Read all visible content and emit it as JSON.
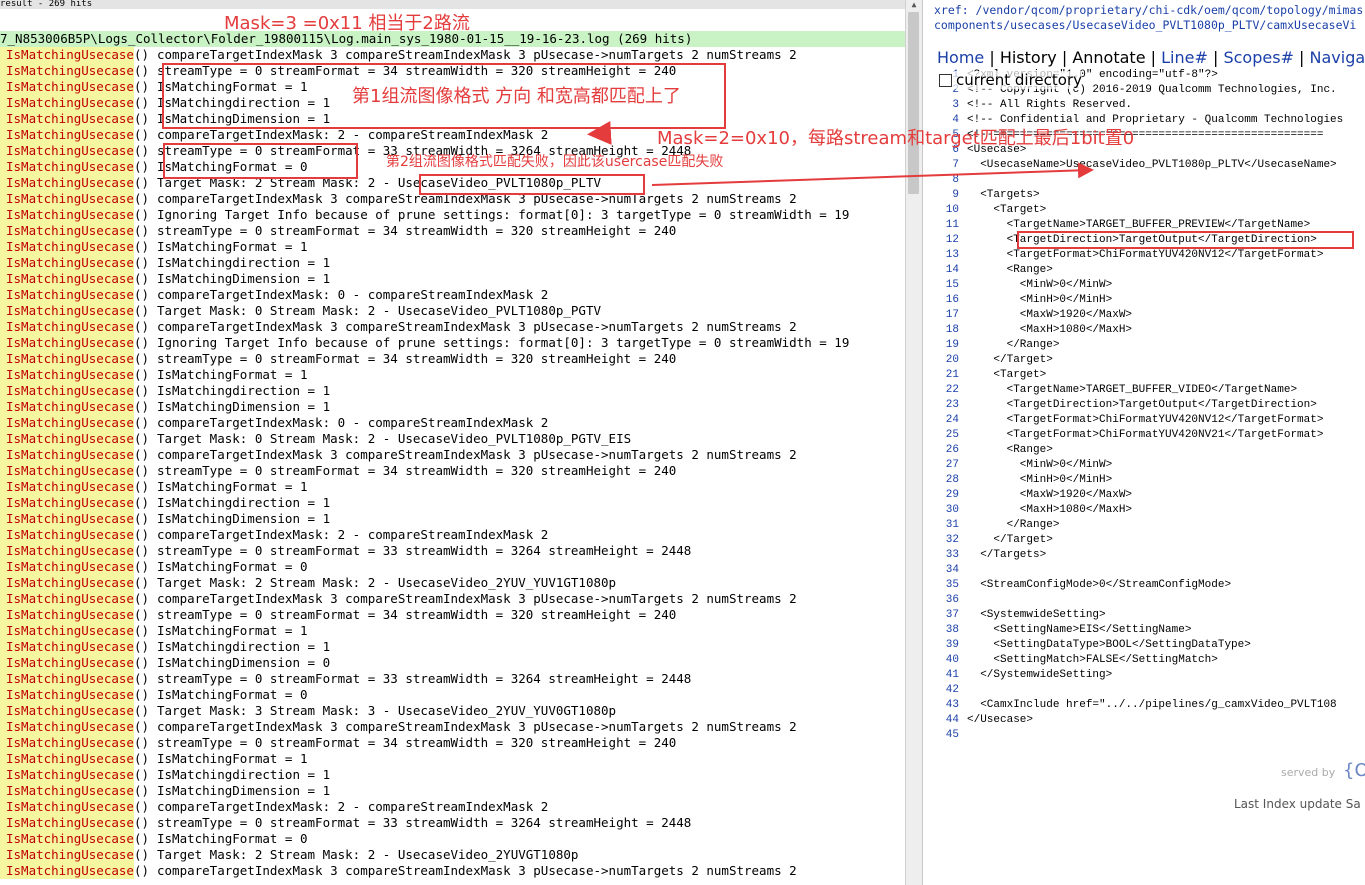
{
  "left_pane": {
    "result_header": "result - 269 hits",
    "path": "7_N853006B5P\\Logs_Collector\\Folder_19800115\\Log.main_sys_1980-01-15__19-16-23.log (269 hits)",
    "function_name": "IsMatchingUsecase",
    "paren": "()",
    "lines": [
      "compareTargetIndexMask 3 compareStreamIndexMask 3 pUsecase->numTargets 2 numStreams 2",
      "streamType = 0 streamFormat = 34 streamWidth = 320 streamHeight = 240",
      "IsMatchingFormat = 1",
      "IsMatchingdirection = 1",
      "IsMatchingDimension = 1",
      "compareTargetIndexMask: 2 - compareStreamIndexMask 2",
      "streamType = 0 streamFormat = 33 streamWidth = 3264 streamHeight = 2448",
      "IsMatchingFormat = 0",
      "Target Mask: 2 Stream Mask: 2 - UsecaseVideo_PVLT1080p_PLTV",
      "compareTargetIndexMask 3 compareStreamIndexMask 3 pUsecase->numTargets 2 numStreams 2",
      "Ignoring Target Info because of prune settings: format[0]: 3 targetType = 0 streamWidth = 19",
      "streamType = 0 streamFormat = 34 streamWidth = 320 streamHeight = 240",
      "IsMatchingFormat = 1",
      "IsMatchingdirection = 1",
      "IsMatchingDimension = 1",
      "compareTargetIndexMask: 0 - compareStreamIndexMask 2",
      "Target Mask: 0 Stream Mask: 2 - UsecaseVideo_PVLT1080p_PGTV",
      "compareTargetIndexMask 3 compareStreamIndexMask 3 pUsecase->numTargets 2 numStreams 2",
      "Ignoring Target Info because of prune settings: format[0]: 3 targetType = 0 streamWidth = 19",
      "streamType = 0 streamFormat = 34 streamWidth = 320 streamHeight = 240",
      "IsMatchingFormat = 1",
      "IsMatchingdirection = 1",
      "IsMatchingDimension = 1",
      "compareTargetIndexMask: 0 - compareStreamIndexMask 2",
      "Target Mask: 0 Stream Mask: 2 - UsecaseVideo_PVLT1080p_PGTV_EIS",
      "compareTargetIndexMask 3 compareStreamIndexMask 3 pUsecase->numTargets 2 numStreams 2",
      "streamType = 0 streamFormat = 34 streamWidth = 320 streamHeight = 240",
      "IsMatchingFormat = 1",
      "IsMatchingdirection = 1",
      "IsMatchingDimension = 1",
      "compareTargetIndexMask: 2 - compareStreamIndexMask 2",
      "streamType = 0 streamFormat = 33 streamWidth = 3264 streamHeight = 2448",
      "IsMatchingFormat = 0",
      "Target Mask: 2 Stream Mask: 2 - UsecaseVideo_2YUV_YUV1GT1080p",
      "compareTargetIndexMask 3 compareStreamIndexMask 3 pUsecase->numTargets 2 numStreams 2",
      "streamType = 0 streamFormat = 34 streamWidth = 320 streamHeight = 240",
      "IsMatchingFormat = 1",
      "IsMatchingdirection = 1",
      "IsMatchingDimension = 0",
      "streamType = 0 streamFormat = 33 streamWidth = 3264 streamHeight = 2448",
      "IsMatchingFormat = 0",
      "Target Mask: 3 Stream Mask: 3 - UsecaseVideo_2YUV_YUV0GT1080p",
      "compareTargetIndexMask 3 compareStreamIndexMask 3 pUsecase->numTargets 2 numStreams 2",
      "streamType = 0 streamFormat = 34 streamWidth = 320 streamHeight = 240",
      "IsMatchingFormat = 1",
      "IsMatchingdirection = 1",
      "IsMatchingDimension = 1",
      "compareTargetIndexMask: 2 - compareStreamIndexMask 2",
      "streamType = 0 streamFormat = 33 streamWidth = 3264 streamHeight = 2448",
      "IsMatchingFormat = 0",
      "Target Mask: 2 Stream Mask: 2 - UsecaseVideo_2YUVGT1080p",
      "compareTargetIndexMask 3 compareStreamIndexMask 3 pUsecase->numTargets 2 numStreams 2"
    ]
  },
  "annotations": {
    "mask3": "Mask=3 =0x11 相当于2路流",
    "group1": "第1组流图像格式 方向 和宽高都匹配上了",
    "mask2": "Mask=2=0x10，每路stream和target匹配上最后1bit置0",
    "group2": "第2组流图像格式匹配失败，因此该usercase匹配失败",
    "usecase_box": "UsecaseVideo_PVLT1080p_PLTV"
  },
  "right_pane": {
    "xref_line1": "xref: /vendor/qcom/proprietary/chi-cdk/oem/qcom/topology/mimas",
    "xref_line2": "components/usecases/UsecaseVideo_PVLT1080p_PLTV/camxUsecaseVi",
    "nav": {
      "home": "Home",
      "history": "History",
      "annotate": "Annotate",
      "line": "Line#",
      "scopes": "Scopes#",
      "navigate": "Navigate"
    },
    "current_directory": "current directory",
    "code_lines": [
      {
        "n": "1",
        "t": "<?xml version=\"1.0\" encoding=\"utf-8\"?>"
      },
      {
        "n": "2",
        "t": "<!-- Copyright (c) 2016-2019 Qualcomm Technologies, Inc."
      },
      {
        "n": "3",
        "t": "<!-- All Rights Reserved."
      },
      {
        "n": "4",
        "t": "<!-- Confidential and Proprietary - Qualcomm Technologies"
      },
      {
        "n": "5",
        "t": "<!--=================================================="
      },
      {
        "n": "6",
        "t": "<Usecase>"
      },
      {
        "n": "7",
        "t": "  <UsecaseName>UsecaseVideo_PVLT1080p_PLTV</UsecaseName>"
      },
      {
        "n": "8",
        "t": ""
      },
      {
        "n": "9",
        "t": "  <Targets>"
      },
      {
        "n": "10",
        "t": "    <Target>"
      },
      {
        "n": "11",
        "t": "      <TargetName>TARGET_BUFFER_PREVIEW</TargetName>"
      },
      {
        "n": "12",
        "t": "      <TargetDirection>TargetOutput</TargetDirection>"
      },
      {
        "n": "13",
        "t": "      <TargetFormat>ChiFormatYUV420NV12</TargetFormat>"
      },
      {
        "n": "14",
        "t": "      <Range>"
      },
      {
        "n": "15",
        "t": "        <MinW>0</MinW>"
      },
      {
        "n": "16",
        "t": "        <MinH>0</MinH>"
      },
      {
        "n": "17",
        "t": "        <MaxW>1920</MaxW>"
      },
      {
        "n": "18",
        "t": "        <MaxH>1080</MaxH>"
      },
      {
        "n": "19",
        "t": "      </Range>"
      },
      {
        "n": "20",
        "t": "    </Target>"
      },
      {
        "n": "21",
        "t": "    <Target>"
      },
      {
        "n": "22",
        "t": "      <TargetName>TARGET_BUFFER_VIDEO</TargetName>"
      },
      {
        "n": "23",
        "t": "      <TargetDirection>TargetOutput</TargetDirection>"
      },
      {
        "n": "24",
        "t": "      <TargetFormat>ChiFormatYUV420NV12</TargetFormat>"
      },
      {
        "n": "25",
        "t": "      <TargetFormat>ChiFormatYUV420NV21</TargetFormat>"
      },
      {
        "n": "26",
        "t": "      <Range>"
      },
      {
        "n": "27",
        "t": "        <MinW>0</MinW>"
      },
      {
        "n": "28",
        "t": "        <MinH>0</MinH>"
      },
      {
        "n": "29",
        "t": "        <MaxW>1920</MaxW>"
      },
      {
        "n": "30",
        "t": "        <MaxH>1080</MaxH>"
      },
      {
        "n": "31",
        "t": "      </Range>"
      },
      {
        "n": "32",
        "t": "    </Target>"
      },
      {
        "n": "33",
        "t": "  </Targets>"
      },
      {
        "n": "34",
        "t": ""
      },
      {
        "n": "35",
        "t": "  <StreamConfigMode>0</StreamConfigMode>"
      },
      {
        "n": "36",
        "t": ""
      },
      {
        "n": "37",
        "t": "  <SystemwideSetting>"
      },
      {
        "n": "38",
        "t": "    <SettingName>EIS</SettingName>"
      },
      {
        "n": "39",
        "t": "    <SettingDataType>BOOL</SettingDataType>"
      },
      {
        "n": "40",
        "t": "    <SettingMatch>FALSE</SettingMatch>"
      },
      {
        "n": "41",
        "t": "  </SystemwideSetting>"
      },
      {
        "n": "42",
        "t": ""
      },
      {
        "n": "43",
        "t": "  <CamxInclude href=\"../../pipelines/g_camxVideo_PVLT108"
      },
      {
        "n": "44",
        "t": "</Usecase>"
      },
      {
        "n": "45",
        "t": ""
      }
    ],
    "served_by": "served by",
    "logo_text": "{Op",
    "last_index": "Last Index update Sa"
  },
  "colors": {
    "annotation_red": "#e43c3c",
    "function_red": "#c00000",
    "highlight_yellow": "#f6f6a0",
    "path_green": "#c9f3c4",
    "link_blue": "#1a3fa8"
  }
}
